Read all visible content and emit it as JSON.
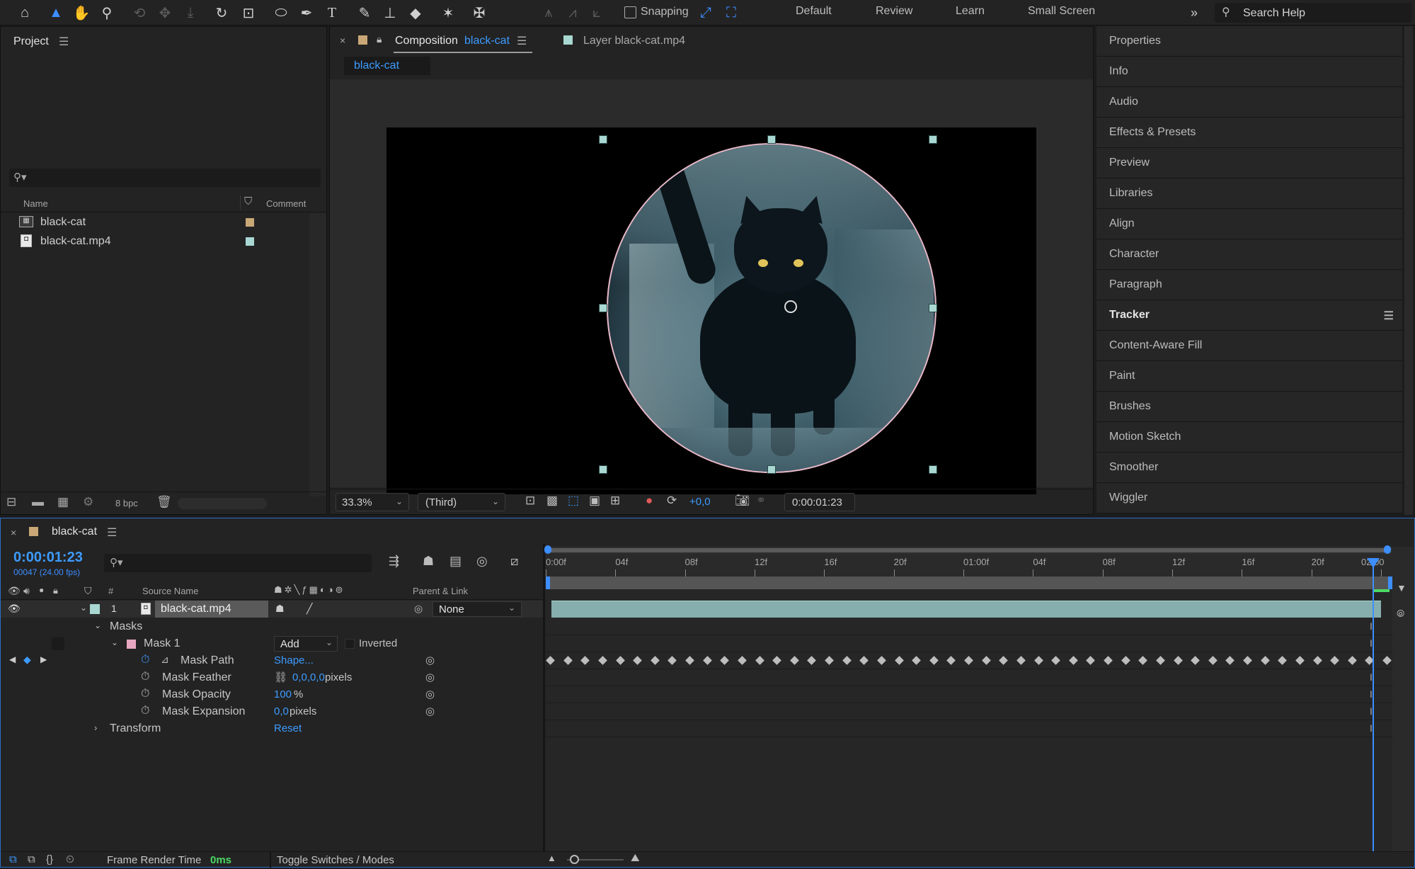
{
  "toolbar": {
    "snapping_label": "Snapping",
    "workspaces": [
      "Default",
      "Review",
      "Learn",
      "Small Screen"
    ],
    "search_placeholder": "Search Help",
    "icons": [
      "home-icon",
      "selection-icon",
      "hand-icon",
      "zoom-icon",
      "orbit-icon",
      "pan-icon",
      "dolly-icon",
      "rotate-icon",
      "anchor-icon",
      "ellipse-icon",
      "pen-icon",
      "type-icon",
      "brush-icon",
      "stamp-icon",
      "eraser-icon",
      "roto-icon",
      "puppet-icon"
    ]
  },
  "project": {
    "title": "Project",
    "search_placeholder": "",
    "col_name": "Name",
    "col_comment": "Comment",
    "items": [
      {
        "name": "black-cat",
        "color": "#c9a876"
      },
      {
        "name": "black-cat.mp4",
        "color": "#a9d7d2"
      }
    ],
    "bpc": "8 bpc"
  },
  "viewer": {
    "comp_tab_label": "Composition",
    "comp_tab_name": "black-cat",
    "layer_tab_label": "Layer black-cat.mp4",
    "breadcrumb": "black-cat",
    "zoom": "33.3%",
    "resolution": "(Third)",
    "exposure": "+0,0",
    "timecode": "0:00:01:23"
  },
  "right_panels": {
    "items": [
      "Properties",
      "Info",
      "Audio",
      "Effects & Presets",
      "Preview",
      "Libraries",
      "Align",
      "Character",
      "Paragraph",
      "Tracker",
      "Content-Aware Fill",
      "Paint",
      "Brushes",
      "Motion Sketch",
      "Smoother",
      "Wiggler"
    ],
    "active": "Tracker"
  },
  "timeline": {
    "tab_name": "black-cat",
    "current_time": "0:00:01:23",
    "frame_info": "00047 (24.00 fps)",
    "col_source": "Source Name",
    "col_parent": "Parent & Link",
    "layer": {
      "num": "1",
      "name": "black-cat.mp4",
      "parent": "None"
    },
    "masks_label": "Masks",
    "mask_name": "Mask 1",
    "mask_mode": "Add",
    "inverted_label": "Inverted",
    "props": [
      {
        "name": "Mask Path",
        "value": "Shape...",
        "unit": ""
      },
      {
        "name": "Mask Feather",
        "value": "0,0,0,0",
        "unit": " pixels"
      },
      {
        "name": "Mask Opacity",
        "value": "100",
        "unit": "%"
      },
      {
        "name": "Mask Expansion",
        "value": "0,0",
        "unit": " pixels"
      }
    ],
    "transform_label": "Transform",
    "transform_value": "Reset",
    "ruler": [
      "0:00f",
      "04f",
      "08f",
      "12f",
      "16f",
      "20f",
      "01:00f",
      "04f",
      "08f",
      "12f",
      "16f",
      "20f",
      "02:00"
    ],
    "keyframe_count": 49,
    "frame_render_label": "Frame Render Time",
    "frame_render_value": "0ms",
    "toggle_label": "Toggle Switches / Modes"
  }
}
